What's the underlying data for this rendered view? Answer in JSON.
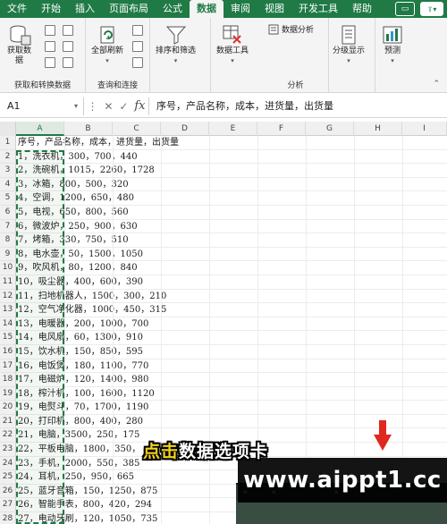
{
  "ribbon_tabs": [
    "文件",
    "开始",
    "插入",
    "页面布局",
    "公式",
    "数据",
    "审阅",
    "视图",
    "开发工具",
    "帮助"
  ],
  "active_tab": "数据",
  "ribbon": {
    "get_data_label": "获取数\n据",
    "group_get_transform": "获取和转换数据",
    "refresh_all_label": "全部刷新",
    "group_queries": "查询和连接",
    "sort_filter_label": "排序和筛选",
    "data_tools_label": "数据工具",
    "data_analysis_label": "数据分析",
    "outline_label": "分级显示",
    "forecast_label": "预测",
    "group_analysis": "分析"
  },
  "formula_bar": {
    "cell_ref": "A1",
    "fx_symbol": "fx",
    "content": "序号，产品名称，成本，进货量，出货量"
  },
  "columns": [
    "A",
    "B",
    "C",
    "D",
    "E",
    "F",
    "G",
    "H",
    "I"
  ],
  "selected_column": "A",
  "rows": [
    "序号，产品名称，成本，进货量，出货量",
    "1，洗衣机，300，700，440",
    "2，洗碗机，1015，2260，1728",
    "3，冰箱，800，500，320",
    "4，空调，1200，650，480",
    "5，电视，650，800，560",
    "6，微波炉，250，900，630",
    "7，烤箱，330，750，510",
    "8，电水壶，50，1500，1050",
    "9，吹风机，80，1200，840",
    "10，吸尘器，400，600，390",
    "11，扫地机器人，1500，300，210",
    "12，空气净化器，1000，450，315",
    "13，电暖器，200，1000，700",
    "14，电风扇，60，1300，910",
    "15，饮水机，150，850，595",
    "16，电饭煲，180，1100，770",
    "17，电磁炉，120，1400，980",
    "18，榨汁机，100，1600，1120",
    "19，电熨斗，70，1700，1190",
    "20，打印机，800，400，280",
    "21，电脑，3500，250，175",
    "22，平板电脑，1800，350，",
    "23，手机，2000，550，385",
    "24，耳机，250，950，665",
    "25，蓝牙音箱，150，1250，875",
    "26，智能手表，800，420，294",
    "27，电动牙刷，120，1050，735"
  ],
  "overlay": {
    "caption_highlight": "点击",
    "caption_rest": "数据选项卡",
    "watermark": "www.aippt1.cc"
  }
}
